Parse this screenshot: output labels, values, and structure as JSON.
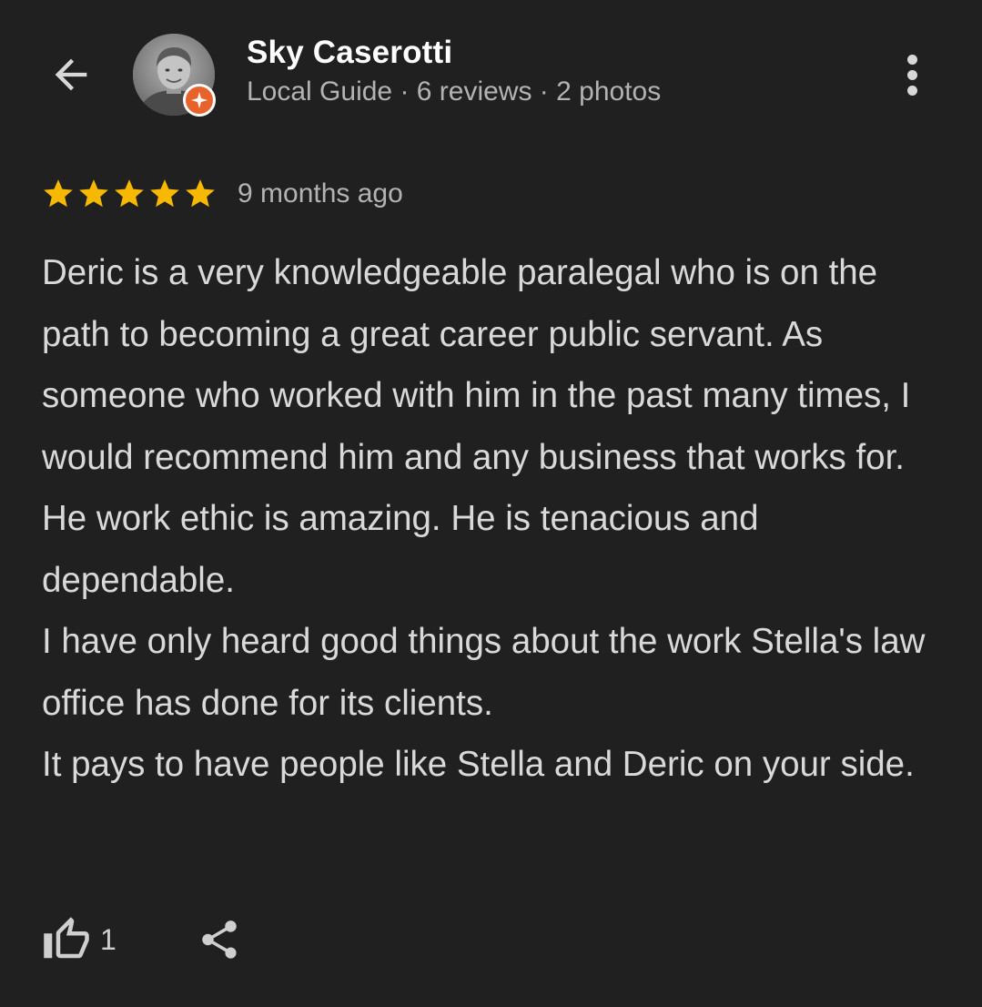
{
  "reviewer": {
    "name": "Sky Caserotti",
    "meta": "Local Guide · 6 reviews · 2 photos",
    "avatar_icon": "person-photo",
    "badge_icon": "local-guide-badge-icon",
    "badge_color": "#e8632b"
  },
  "review": {
    "rating": 5,
    "rating_max": 5,
    "star_color": "#f6b800",
    "time_ago": "9 months ago",
    "text": "Deric is a very knowledgeable paralegal who is on the path to becoming a great career public servant. As someone who worked with him in the past many times, I would recommend him and any business that works for. He work ethic is amazing. He is tenacious and dependable.\nI have only heard good things about the work Stella's law office has done for its clients.\nIt pays to have people like Stella and Deric on your side."
  },
  "actions": {
    "like_count": "1",
    "like_icon": "thumbs-up-icon",
    "share_icon": "share-icon"
  },
  "theme": {
    "background": "#202020",
    "text_primary": "#ffffff",
    "text_secondary": "#b3b3b3"
  }
}
